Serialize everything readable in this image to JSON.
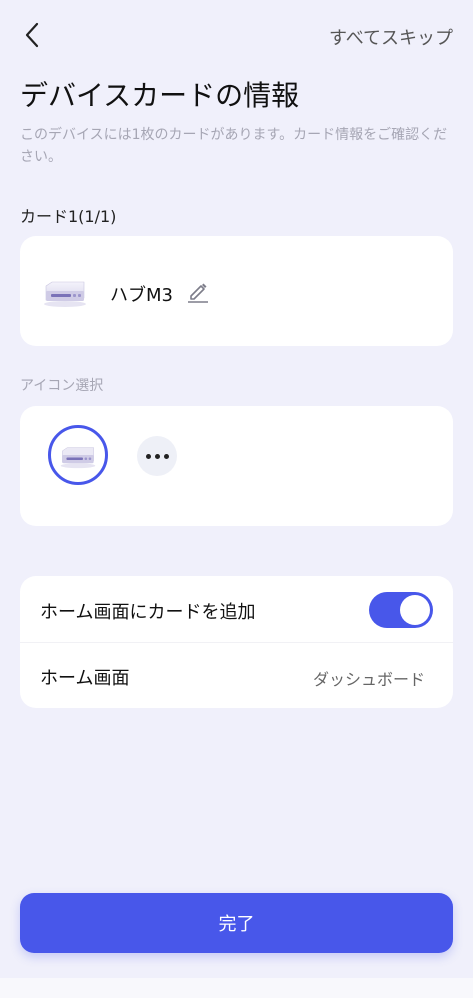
{
  "header": {
    "back_icon": "chevron-left-icon",
    "skip_label": "すべてスキップ"
  },
  "title": "デバイスカードの情報",
  "description": "このデバイスには1枚のカードがあります。カード情報をご確認ください。",
  "card_count_label": "カード1(1/1)",
  "device_card": {
    "thumbnail_icon": "hub-device-icon",
    "name": "ハブM3",
    "edit_icon": "pencil-icon"
  },
  "icon_section": {
    "label": "アイコン選択",
    "selected_icon": "hub-device-icon",
    "more_icon": "more-dots-icon"
  },
  "settings": {
    "add_to_home": {
      "label": "ホーム画面にカードを追加",
      "enabled": true
    },
    "home_screen": {
      "label": "ホーム画面",
      "value": "ダッシュボード"
    }
  },
  "done_button_label": "完了",
  "colors": {
    "accent": "#4857ea",
    "background": "#f0f0fb",
    "card": "#ffffff",
    "muted_text": "#a6a6b4"
  }
}
